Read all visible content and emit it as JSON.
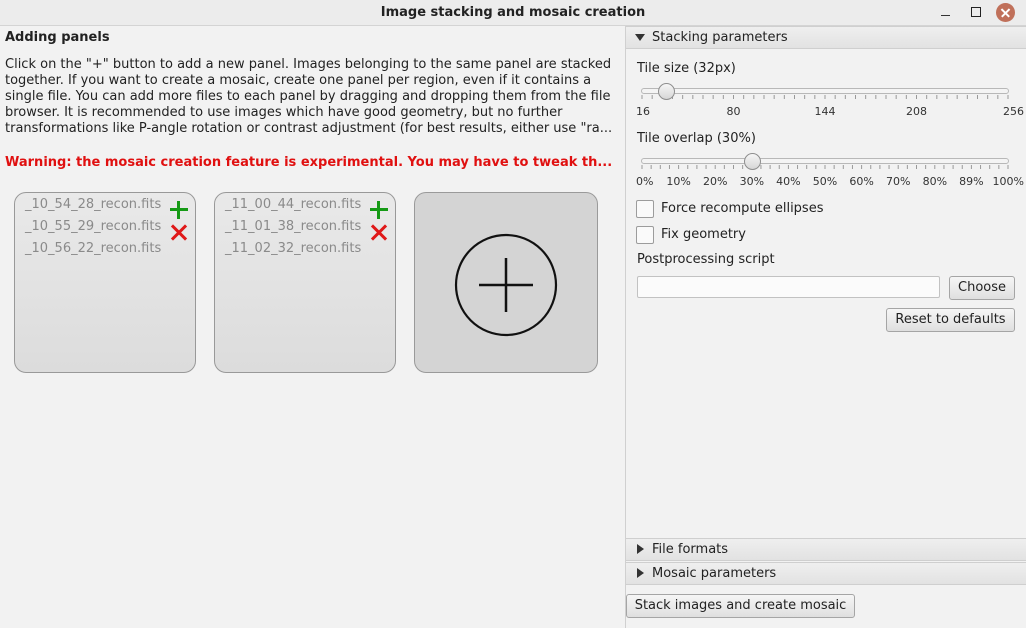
{
  "window": {
    "title": "Image stacking and mosaic creation"
  },
  "left": {
    "heading": "Adding panels",
    "description": "Click on the \"+\" button to add a new panel. Images belonging to the same panel are stacked together. If you want to create a mosaic, create one panel per region, even if it contains a single file. You can add more files to each panel by dragging and dropping them from the file browser. It is recommended to use images which have good geometry, but no further transformations like P-angle rotation or contrast adjustment (for best results, either use \"ra...",
    "warning": "Warning: the mosaic creation feature is experimental. You may have to tweak th...",
    "panels": [
      {
        "files": [
          "_10_54_28_recon.fits",
          "_10_55_29_recon.fits",
          "_10_56_22_recon.fits"
        ]
      },
      {
        "files": [
          "_11_00_44_recon.fits",
          "_11_01_38_recon.fits",
          "_11_02_32_recon.fits"
        ]
      }
    ],
    "icons": {
      "add": "plus-icon",
      "remove": "remove-icon",
      "new_panel": "circle-plus-icon"
    },
    "colors": {
      "warning": "#e01010",
      "add": "#159a15",
      "remove": "#e01818"
    }
  },
  "right": {
    "stacking_header": "Stacking parameters",
    "tile_size": {
      "label": "Tile size (32px)",
      "value": 32,
      "min": 16,
      "max": 256,
      "ticks": [
        "16",
        "80",
        "144",
        "208",
        "256"
      ]
    },
    "tile_overlap": {
      "label": "Tile overlap (30%)",
      "value": 30,
      "min": 0,
      "max": 100,
      "ticks": [
        "0%",
        "10%",
        "20%",
        "30%",
        "40%",
        "50%",
        "60%",
        "70%",
        "80%",
        "89%",
        "100%"
      ]
    },
    "force_recompute_ellipses": {
      "label": "Force recompute ellipses",
      "checked": false
    },
    "fix_geometry": {
      "label": "Fix geometry",
      "checked": false
    },
    "postprocessing": {
      "label": "Postprocessing script",
      "value": "",
      "choose_label": "Choose"
    },
    "reset_label": "Reset to defaults",
    "file_formats_header": "File formats",
    "mosaic_parameters_header": "Mosaic parameters"
  },
  "footer": {
    "stack_button": "Stack images and create mosaic"
  }
}
